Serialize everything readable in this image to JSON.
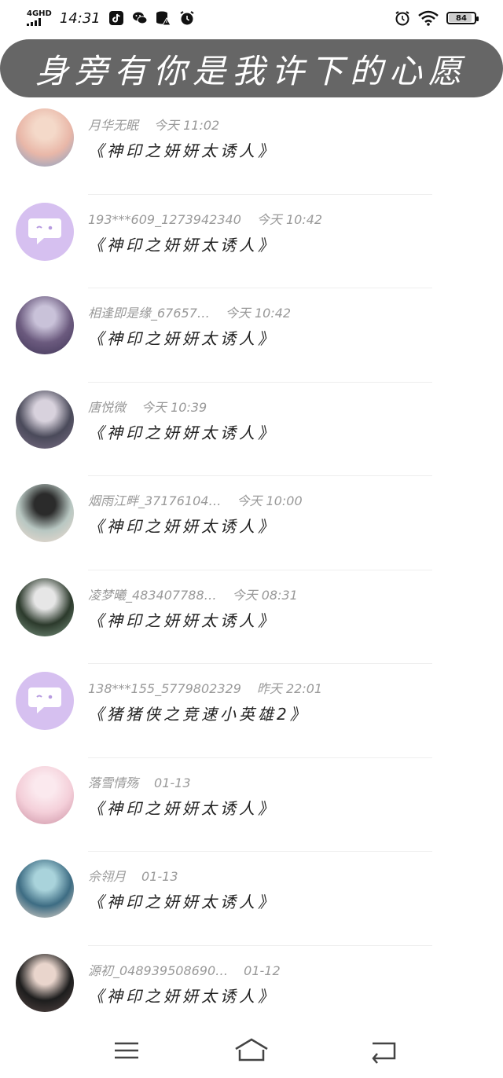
{
  "status_bar": {
    "network": "4GHD",
    "time": "14:31",
    "battery": "84",
    "battery_level_percent": 84
  },
  "header": {
    "title": "身旁有你是我许下的心愿"
  },
  "messages": [
    {
      "name": "月华无眠",
      "time": "今天 11:02",
      "game": "《神印之妍妍太诱人》",
      "avatar": "photo-tiger",
      "colors": [
        "#e9b7a8",
        "#f4d9c9",
        "#7fa0c8"
      ]
    },
    {
      "name": "193***609_1273942340",
      "time": "今天 10:42",
      "game": "《神印之妍妍太诱人》",
      "avatar": "chat-icon"
    },
    {
      "name": "相逢即是缘_67657…",
      "time": "今天 10:42",
      "game": "《神印之妍妍太诱人》",
      "avatar": "photo-scene",
      "colors": [
        "#6b5a7e",
        "#c9c2d9",
        "#3e3456"
      ]
    },
    {
      "name": "唐悦微",
      "time": "今天 10:39",
      "game": "《神印之妍妍太诱人》",
      "avatar": "photo-girl",
      "colors": [
        "#4a4a5a",
        "#d8d2dd",
        "#7c6f87"
      ]
    },
    {
      "name": "烟雨江畔_37176104…",
      "time": "今天 10:00",
      "game": "《神印之妍妍太诱人》",
      "avatar": "photo-girl",
      "colors": [
        "#b8c7c2",
        "#2b2b2b",
        "#f2dcd0"
      ]
    },
    {
      "name": "凌梦曦_483407788…",
      "time": "今天 08:31",
      "game": "《神印之妍妍太诱人》",
      "avatar": "photo-scene",
      "colors": [
        "#2c3a2c",
        "#e6e6e6",
        "#7f9a86"
      ]
    },
    {
      "name": "138***155_5779802329",
      "time": "昨天 22:01",
      "game": "《猪猪侠之竞速小英雄2》",
      "avatar": "chat-icon"
    },
    {
      "name": "落雪情殇",
      "time": "01-13",
      "game": "《神印之妍妍太诱人》",
      "avatar": "photo-girl",
      "colors": [
        "#f4cfd9",
        "#fbe9ee",
        "#c98ea1"
      ]
    },
    {
      "name": "佘翎月",
      "time": "01-13",
      "game": "《神印之妍妍太诱人》",
      "avatar": "photo-boy",
      "colors": [
        "#3d6c83",
        "#a9d3db",
        "#f3e0d2"
      ]
    },
    {
      "name": "源初_048939508690…",
      "time": "01-12",
      "game": "《神印之妍妍太诱人》",
      "avatar": "photo-couple",
      "colors": [
        "#1d1d1d",
        "#e9d5cc",
        "#5b4a48"
      ]
    }
  ],
  "colors": {
    "title_pill": "#666666",
    "chat_avatar": "#d6c0f0",
    "meta_text": "#999999",
    "divider": "#eeeeee"
  }
}
